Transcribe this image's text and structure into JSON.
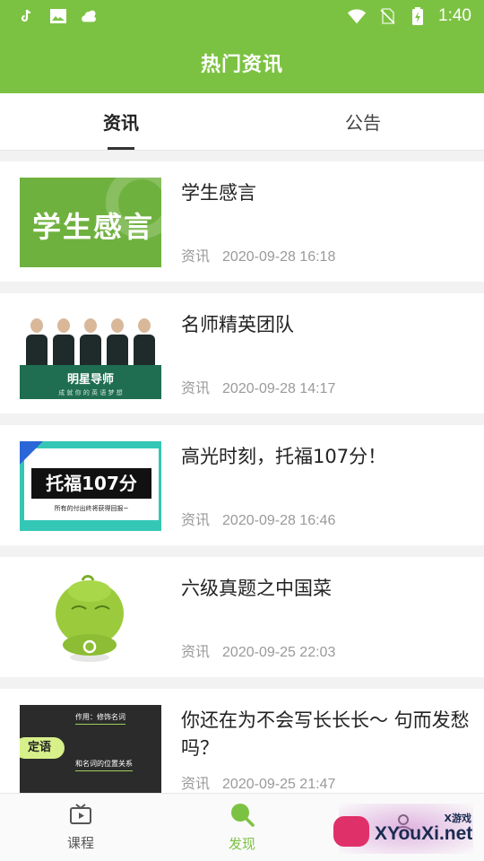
{
  "status_bar": {
    "time": "1:40",
    "icons": [
      "tiktok-icon",
      "image-icon",
      "weather-icon",
      "wifi-icon",
      "no-sim-icon",
      "battery-charging-icon"
    ]
  },
  "app_bar": {
    "title": "热门资讯"
  },
  "tabs": [
    {
      "label": "资讯",
      "active": true
    },
    {
      "label": "公告",
      "active": false
    }
  ],
  "articles": [
    {
      "title": "学生感言",
      "category": "资讯",
      "time": "2020-09-28 16:18",
      "thumb_text": "学生感言"
    },
    {
      "title": "名师精英团队",
      "category": "资讯",
      "time": "2020-09-28 14:17",
      "thumb_text": "明星导师",
      "thumb_sub": "成 就 你 的 英 语 梦 想"
    },
    {
      "title": "高光时刻，托福107分！",
      "category": "资讯",
      "time": "2020-09-28 16:46",
      "thumb_text": "托福107分",
      "thumb_sub": "所有的付出终将获得回报~"
    },
    {
      "title": "六级真题之中国菜",
      "category": "资讯",
      "time": "2020-09-25 22:03"
    },
    {
      "title": "你还在为不会写长长长～ 句而发愁吗？",
      "category": "资讯",
      "time": "2020-09-25 21:47",
      "thumb_text": "定语",
      "thumb_sub1": "作用：修饰名词",
      "thumb_sub2": "和名词的位置关系"
    }
  ],
  "bottom_nav": [
    {
      "label": "课程",
      "icon": "tv-play-icon",
      "active": false
    },
    {
      "label": "发现",
      "icon": "search-icon",
      "active": true
    },
    {
      "label": "",
      "icon": "profile-icon",
      "active": false
    }
  ],
  "watermark": {
    "main": "XYouXi.net",
    "sub": "X游戏"
  },
  "colors": {
    "primary": "#7cc242",
    "background": "#f2f2f2",
    "meta_text": "#9a9a9a"
  }
}
